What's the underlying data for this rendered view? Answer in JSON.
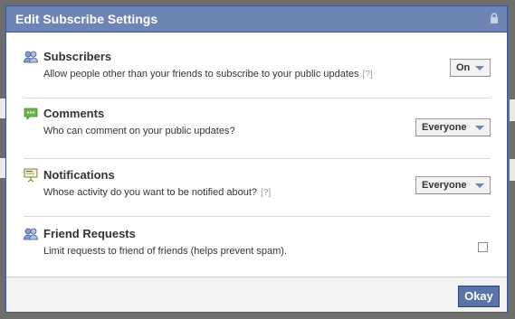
{
  "dialog": {
    "title": "Edit Subscribe Settings",
    "lock_icon": "lock-icon"
  },
  "rows": [
    {
      "title": "Subscribers",
      "description": "Allow people other than your friends to subscribe to your public updates",
      "help": "[?]",
      "control": "dropdown",
      "value": "On",
      "icon": "subscribers-icon"
    },
    {
      "title": "Comments",
      "description": "Who can comment on your public updates?",
      "control": "dropdown",
      "value": "Everyone",
      "icon": "comments-icon"
    },
    {
      "title": "Notifications",
      "description": "Whose activity do you want to be notified about?",
      "help": "[?]",
      "control": "dropdown",
      "value": "Everyone",
      "icon": "notifications-icon"
    },
    {
      "title": "Friend Requests",
      "description": "Limit requests to friend of friends (helps prevent spam).",
      "control": "checkbox",
      "checked": false,
      "icon": "friend-requests-icon"
    }
  ],
  "footer": {
    "okay_label": "Okay"
  },
  "colors": {
    "titlebar": "#6d84b4",
    "border": "#3b5998",
    "button": "#5b74a8"
  }
}
